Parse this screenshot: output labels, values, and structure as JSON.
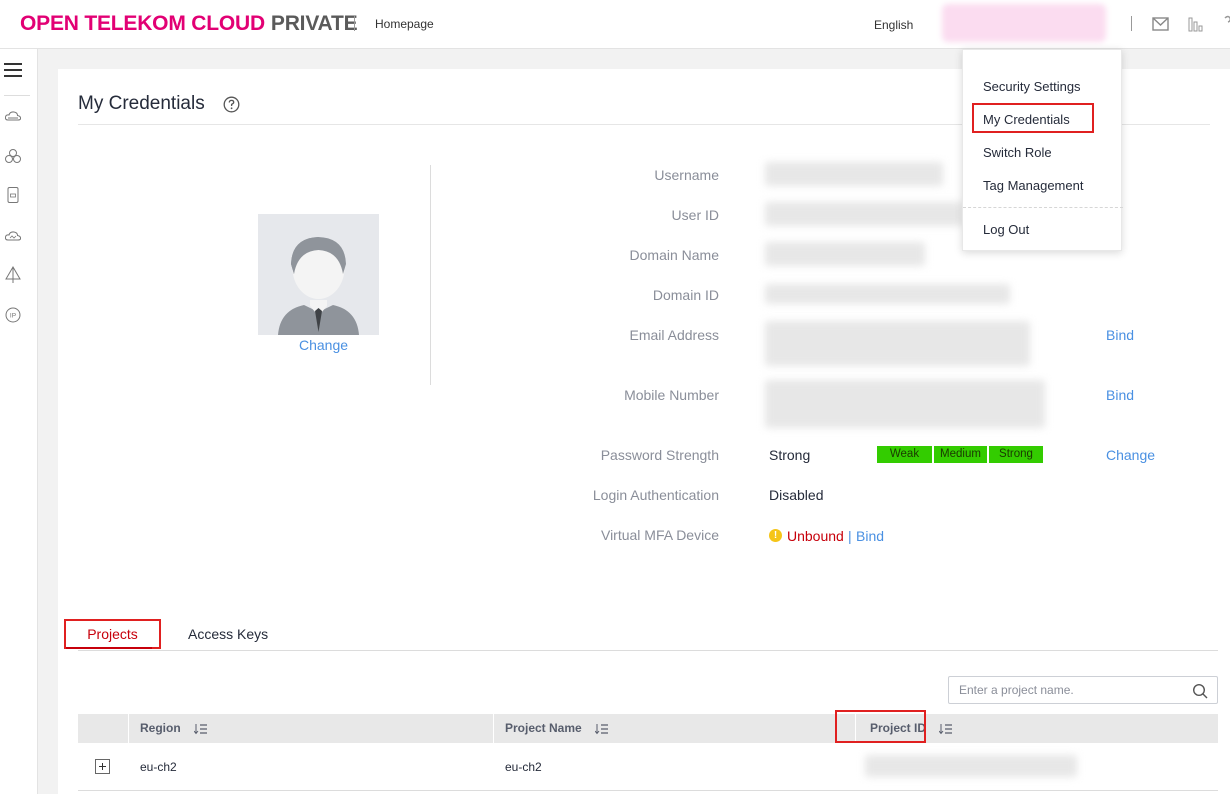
{
  "header": {
    "brand": "OPEN TELEKOM CLOUD",
    "brand_suffix": "PRIVATE",
    "homepage": "Homepage",
    "language": "English"
  },
  "page": {
    "title": "My Credentials"
  },
  "profile": {
    "avatar_change": "Change",
    "fields": {
      "username": "Username",
      "user_id": "User ID",
      "domain_name": "Domain Name",
      "domain_id": "Domain ID",
      "email": "Email Address",
      "mobile": "Mobile Number",
      "password_strength": "Password Strength",
      "login_auth": "Login Authentication",
      "mfa": "Virtual MFA Device"
    },
    "values": {
      "password_strength": "Strong",
      "login_auth": "Disabled",
      "mfa_status": "Unbound",
      "mfa_separator": "|",
      "mfa_bind": "Bind"
    },
    "strength_bar": [
      "Weak",
      "Medium",
      "Strong"
    ],
    "email_bind": "Bind",
    "mobile_bind": "Bind",
    "password_change": "Change"
  },
  "tabs": [
    {
      "label": "Projects",
      "active": true
    },
    {
      "label": "Access Keys",
      "active": false
    }
  ],
  "search": {
    "placeholder": "Enter a project name."
  },
  "table": {
    "columns": [
      "Region",
      "Project Name",
      "Project ID"
    ],
    "rows": [
      {
        "region": "eu-ch2",
        "project_name": "eu-ch2",
        "project_id": ""
      }
    ]
  },
  "user_menu": {
    "items": [
      "Security Settings",
      "My Credentials",
      "Switch Role",
      "Tag Management",
      "Log Out"
    ],
    "highlighted": "My Credentials"
  },
  "colors": {
    "brand": "#e20074",
    "link": "#4a90e2",
    "active_tab": "#c7000b",
    "strength": "#33cc00",
    "highlight_box": "#e02020"
  },
  "icons": {
    "rail": [
      "menu-icon",
      "cloud-server-icon",
      "cluster-icon",
      "storage-icon",
      "cloud-icon",
      "network-icon",
      "ip-icon"
    ],
    "header": [
      "mail-icon",
      "stats-icon",
      "help-icon"
    ]
  }
}
